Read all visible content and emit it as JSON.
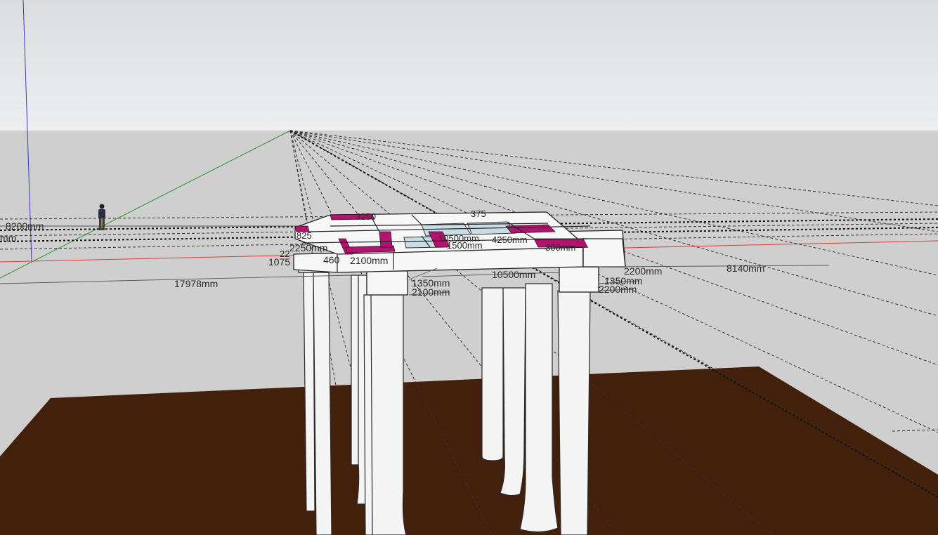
{
  "viewport": {
    "sky_color": "#e7e8ea",
    "ground_color": "#cfcfcf",
    "terrain_color": "#42200c",
    "accent_magenta": "#b0146e",
    "axis_colors": {
      "red": "#e23a3a",
      "green": "#3a9a3a",
      "blue": "#3a3ad0"
    }
  },
  "scene_objects": {
    "person_figure": "scale-figure-icon",
    "structure": "bridge-deck-on-columns"
  },
  "dimensions": {
    "d_8200": "8200mm",
    "d_mm_cut": "mm",
    "d_17978": "17978mm",
    "d_2250": "2250mm",
    "d_1075": "1075",
    "d_460": "460",
    "d_2100_left": "2100mm",
    "d_1350_left": "1350mm",
    "d_2100_low": "2100mm",
    "d_10500": "10500mm",
    "d_10500_top": "10500mm",
    "d_1350_right": "1350mm",
    "d_2200_upper": "2200mm",
    "d_2200_lower": "2200mm",
    "d_8140": "8140mm",
    "d_300": "300mm",
    "d_825": "825",
    "d_22": "22",
    "d_top_a": "375",
    "d_top_b": "3250",
    "d_mid_a": "1500mm",
    "d_mid_b": "4250mm"
  }
}
